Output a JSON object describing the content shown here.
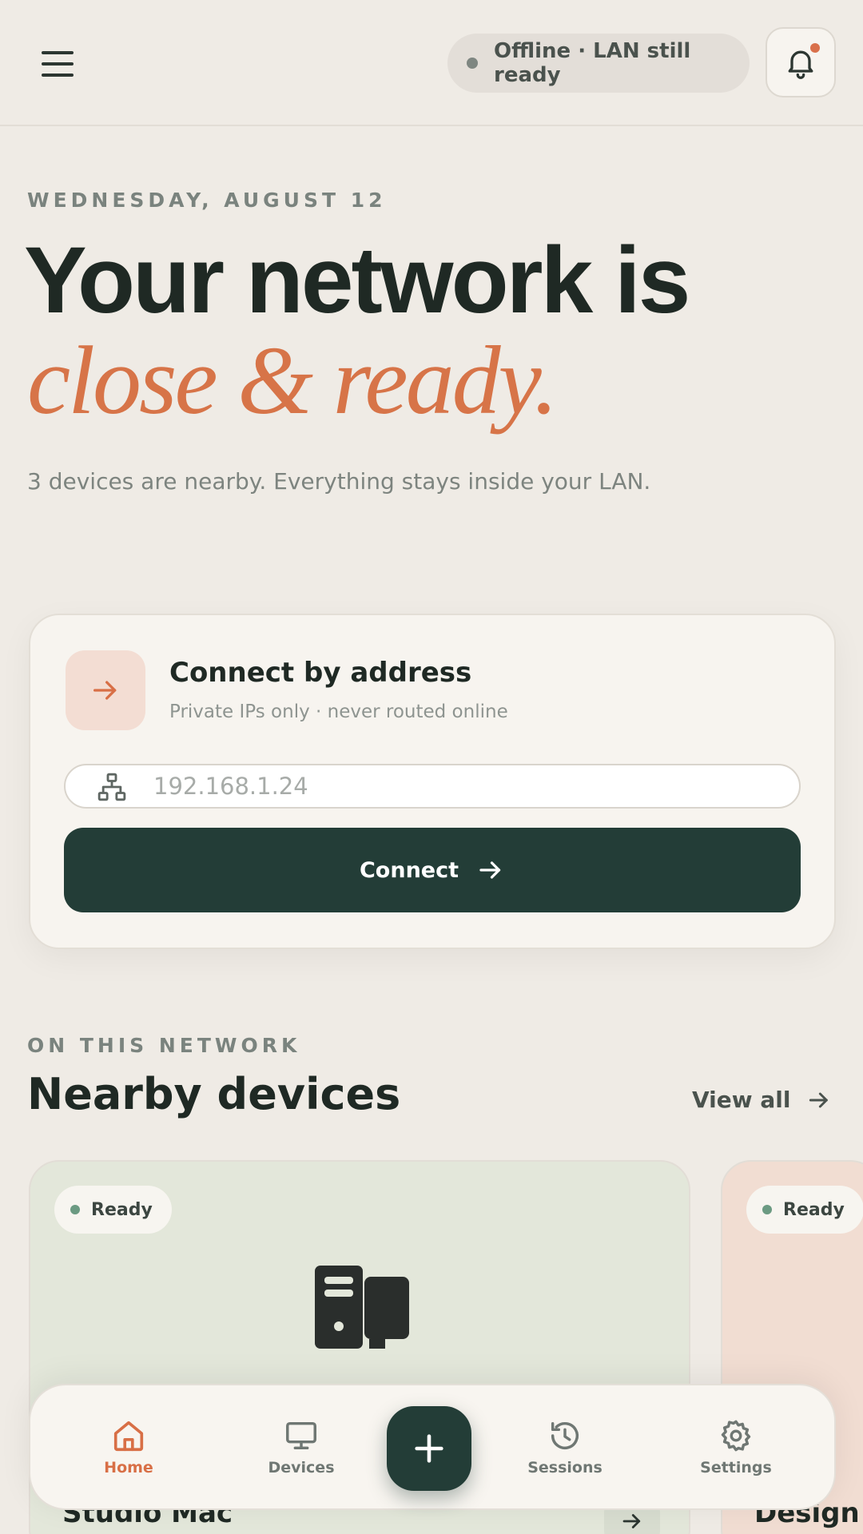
{
  "header": {
    "status_text": "Offline · LAN still ready"
  },
  "hero": {
    "date": "WEDNESDAY, AUGUST 12",
    "title_line1": "Your network is",
    "title_line2": "close & ready.",
    "subtitle": "3 devices are nearby. Everything stays inside your LAN."
  },
  "connect": {
    "title": "Connect by address",
    "subtitle": "Private IPs only · never routed online",
    "address_placeholder": "192.168.1.24",
    "button_label": "Connect"
  },
  "nearby": {
    "eyebrow": "ON THIS NETWORK",
    "title": "Nearby devices",
    "view_all": "View all",
    "devices": [
      {
        "status": "Ready",
        "name": "Studio Mac"
      },
      {
        "status": "Ready",
        "name": "Design"
      }
    ]
  },
  "nav": {
    "items": [
      {
        "label": "Home",
        "icon": "home-icon",
        "active": true
      },
      {
        "label": "Devices",
        "icon": "monitor-icon",
        "active": false
      },
      {
        "label": "Sessions",
        "icon": "history-icon",
        "active": false
      },
      {
        "label": "Settings",
        "icon": "gear-icon",
        "active": false
      }
    ],
    "fab_icon": "plus-icon"
  },
  "colors": {
    "background": "#EFEBE5",
    "primary_dark": "#233D37",
    "accent": "#D77448",
    "ready_green": "#6B9A82"
  }
}
